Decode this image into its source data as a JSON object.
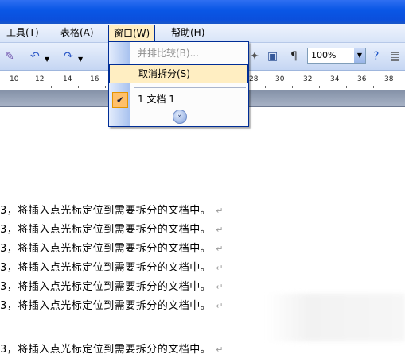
{
  "menubar": {
    "items": [
      {
        "label": "工具(T)"
      },
      {
        "label": "表格(A)"
      },
      {
        "label": "窗口(W)"
      },
      {
        "label": "帮助(H)"
      }
    ]
  },
  "toolbar": {
    "zoom_value": "100%",
    "icons": [
      "ink-icon",
      "undo-icon",
      "redo-icon",
      "document-map-icon",
      "pilcrow-icon",
      "help-icon"
    ]
  },
  "ruler": {
    "left_ticks": [
      "10",
      "12",
      "14",
      "16"
    ],
    "right_ticks": [
      "28",
      "30",
      "32",
      "34",
      "36",
      "38"
    ]
  },
  "window_menu": {
    "items": [
      {
        "label": "并排比较(B)...",
        "enabled": false
      },
      {
        "label": "取消拆分(S)",
        "enabled": true,
        "highlighted": true
      },
      {
        "label": "1 文档 1",
        "checked": true
      }
    ],
    "expand_symbol": "»"
  },
  "document": {
    "lines": [
      "3，将插入点光标定位到需要拆分的文档中。",
      "3，将插入点光标定位到需要拆分的文档中。",
      "3，将插入点光标定位到需要拆分的文档中。",
      "3，将插入点光标定位到需要拆分的文档中。",
      "3，将插入点光标定位到需要拆分的文档中。",
      "3，将插入点光标定位到需要拆分的文档中。",
      "3，将插入点光标定位到需要拆分的文档中。"
    ],
    "paragraph_mark": "↵"
  }
}
